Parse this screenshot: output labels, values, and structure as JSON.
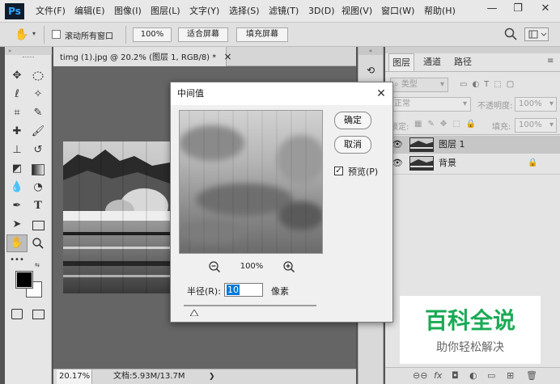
{
  "app": {
    "logo": "Ps"
  },
  "menu": [
    "文件(F)",
    "编辑(E)",
    "图像(I)",
    "图层(L)",
    "文字(Y)",
    "选择(S)",
    "滤镜(T)",
    "3D(D)",
    "视图(V)",
    "窗口(W)",
    "帮助(H)"
  ],
  "window_controls": {
    "minimize": "—",
    "restore": "❐",
    "close": "✕"
  },
  "options_bar": {
    "scroll_all_label": "滚动所有窗口",
    "scroll_all_checked": false,
    "zoom_100": "100%",
    "fit_screen": "适合屏幕",
    "fill_screen": "填充屏幕"
  },
  "document": {
    "tab_title": "timg (1).jpg @ 20.2% (图层 1, RGB/8) *",
    "tab_close": "×",
    "status_zoom": "20.17%",
    "status_doc": "文档:5.93M/13.7M"
  },
  "dialog": {
    "title": "中间值",
    "ok": "确定",
    "cancel": "取消",
    "preview_label": "预览(P)",
    "preview_checked": true,
    "zoom_percent": "100%",
    "radius_label": "半径(R):",
    "radius_value": "10",
    "radius_unit": "像素",
    "radius_slider_fraction": 0.05
  },
  "layers_panel": {
    "tabs": [
      "图层",
      "通道",
      "路径"
    ],
    "filter_kind": "类型",
    "blend_mode": "正常",
    "opacity_label": "不透明度:",
    "opacity_value": "100%",
    "lock_label": "锁定:",
    "fill_label": "填充:",
    "fill_value": "100%",
    "layers": [
      {
        "name": "图层 1",
        "selected": true,
        "locked": false
      },
      {
        "name": "背景",
        "selected": false,
        "locked": true
      }
    ]
  },
  "watermark": {
    "title": "百科全说",
    "subtitle": "助你轻松解决"
  },
  "colors": {
    "accent": "#0078d7",
    "watermark_green": "#1aaa55"
  }
}
